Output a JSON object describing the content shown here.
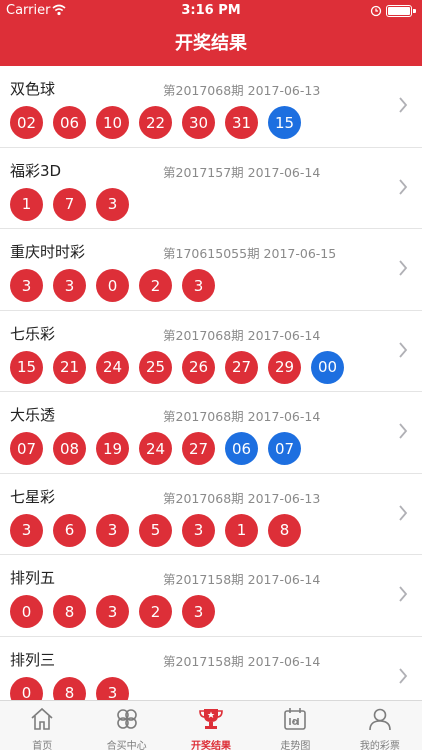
{
  "status_bar": {
    "carrier": "Carrier",
    "time": "3:16 PM"
  },
  "nav": {
    "title": "开奖结果"
  },
  "lotteries": [
    {
      "name": "双色球",
      "issue": "第2017068期 2017-06-13",
      "red": [
        "02",
        "06",
        "10",
        "22",
        "30",
        "31"
      ],
      "blue": [
        "15"
      ]
    },
    {
      "name": "福彩3D",
      "issue": "第2017157期 2017-06-14",
      "red": [
        "1",
        "7",
        "3"
      ],
      "blue": []
    },
    {
      "name": "重庆时时彩",
      "issue": "第170615055期 2017-06-15",
      "red": [
        "3",
        "3",
        "0",
        "2",
        "3"
      ],
      "blue": []
    },
    {
      "name": "七乐彩",
      "issue": "第2017068期 2017-06-14",
      "red": [
        "15",
        "21",
        "24",
        "25",
        "26",
        "27",
        "29"
      ],
      "blue": [
        "00"
      ]
    },
    {
      "name": "大乐透",
      "issue": "第2017068期 2017-06-14",
      "red": [
        "07",
        "08",
        "19",
        "24",
        "27"
      ],
      "blue": [
        "06",
        "07"
      ]
    },
    {
      "name": "七星彩",
      "issue": "第2017068期 2017-06-13",
      "red": [
        "3",
        "6",
        "3",
        "5",
        "3",
        "1",
        "8"
      ],
      "blue": []
    },
    {
      "name": "排列五",
      "issue": "第2017158期 2017-06-14",
      "red": [
        "0",
        "8",
        "3",
        "2",
        "3"
      ],
      "blue": []
    },
    {
      "name": "排列三",
      "issue": "第2017158期 2017-06-14",
      "red": [
        "0",
        "8",
        "3"
      ],
      "blue": []
    }
  ],
  "tabs": [
    {
      "label": "首页",
      "icon": "home-icon",
      "active": false
    },
    {
      "label": "合买中心",
      "icon": "clover-icon",
      "active": false
    },
    {
      "label": "开奖结果",
      "icon": "trophy-icon",
      "active": true
    },
    {
      "label": "走势图",
      "icon": "calendar-trend-icon",
      "active": false
    },
    {
      "label": "我的彩票",
      "icon": "user-icon",
      "active": false
    }
  ],
  "colors": {
    "brand_red": "#dd2f38",
    "ball_blue": "#1d6fe0",
    "tab_inactive": "#7d7d7d"
  }
}
